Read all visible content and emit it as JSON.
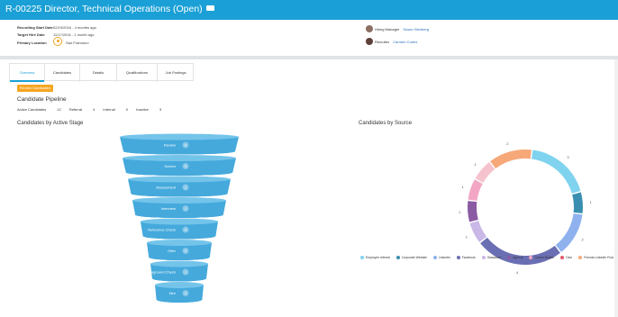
{
  "header": {
    "title": "R-00225 Director, Technical Operations (Open)"
  },
  "info": {
    "recruiting_start_label": "Recruiting Start Date",
    "recruiting_start_value": "02/19/2016 - 4 months ago",
    "target_hire_label": "Target Hire Date",
    "target_hire_value": "11/17/2016 - 1 month ago",
    "primary_location_label": "Primary Location",
    "primary_location_value": "San Francisco",
    "hiring_manager_label": "Hiring Manager",
    "hiring_manager_name": "Susan Stenberg",
    "recruiter_label": "Recruiter",
    "recruiter_name": "Carmen Cortez"
  },
  "tabs": [
    "Overview",
    "Candidates",
    "Details",
    "Qualifications",
    "Job Postings"
  ],
  "review_button": "Review Candidates",
  "pipeline": {
    "title": "Candidate Pipeline",
    "counts": [
      {
        "label": "Active Candidates",
        "value": "12"
      },
      {
        "label": "Referral",
        "value": "4"
      },
      {
        "label": "Internal",
        "value": "0"
      },
      {
        "label": "Inactive",
        "value": "3"
      }
    ]
  },
  "chart_data": [
    {
      "type": "funnel",
      "title": "Candidates by Active Stage",
      "stages": [
        {
          "label": "Review",
          "value": 6
        },
        {
          "label": "Screen",
          "value": 5
        },
        {
          "label": "Assessment",
          "value": 1
        },
        {
          "label": "Interview",
          "value": 1
        },
        {
          "label": "Reference Check",
          "value": 0
        },
        {
          "label": "Offer",
          "value": 0
        },
        {
          "label": "Background Check",
          "value": 1
        },
        {
          "label": "Hire",
          "value": 0
        }
      ]
    },
    {
      "type": "pie",
      "title": "Candidates by Source",
      "slices": [
        {
          "name": "Employee referral",
          "value": 3,
          "color": "#7fd3ef"
        },
        {
          "name": "Corporate Website",
          "value": 1,
          "color": "#3a8fb0"
        },
        {
          "name": "LinkedIn",
          "value": 2,
          "color": "#8fb2ee"
        },
        {
          "name": "Facebook",
          "value": 4,
          "color": "#6a6fb3"
        },
        {
          "name": "Glassdoor",
          "value": 1,
          "color": "#c9b8e8"
        },
        {
          "name": "Agency",
          "value": 1,
          "color": "#8a5aa3"
        },
        {
          "name": "Career Builder",
          "value": 1,
          "color": "#f2a6c4"
        },
        {
          "name": "Dice",
          "value": 1,
          "color": "#f6c2cd"
        },
        {
          "name": "Friends LinkedIn Post",
          "value": 2,
          "color": "#f6a878"
        }
      ]
    }
  ],
  "legend_dot_colors": {
    "Dice": "#e25b6b"
  }
}
